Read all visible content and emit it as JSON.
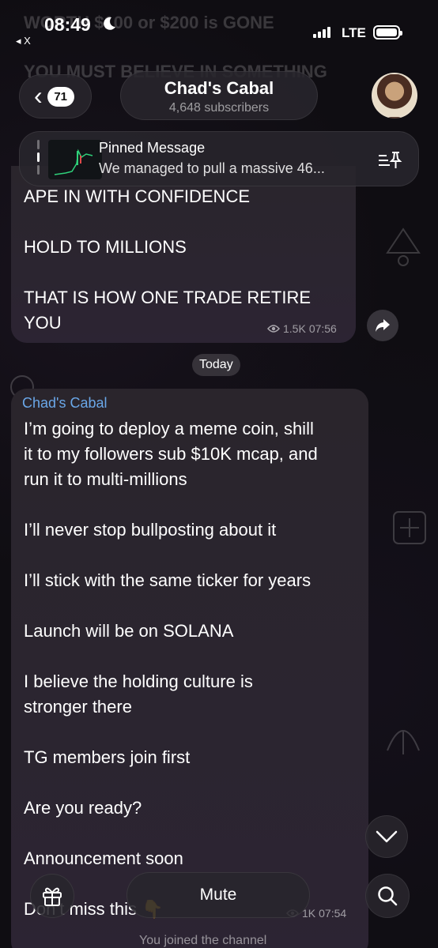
{
  "status_bar": {
    "time": "08:49",
    "back_app": "◂ X",
    "network": "LTE"
  },
  "ghost_text": {
    "line1": "WORTH $100 or $200 is GONE",
    "line2": "YOU MUST BELIEVE IN SOMETHING"
  },
  "header": {
    "back_badge": "71",
    "title": "Chad's Cabal",
    "subtitle": "4,648 subscribers"
  },
  "pinned": {
    "label": "Pinned Message",
    "text": "We managed to pull a massive 46..."
  },
  "message1": {
    "lines": [
      "APE IN WITH CONFIDENCE",
      "HOLD TO MILLIONS",
      "THAT IS HOW ONE TRADE RETIRE",
      "YOU"
    ],
    "views": "1.5K",
    "time": "07:56"
  },
  "date_separator": "Today",
  "message2": {
    "sender": "Chad's Cabal",
    "lines": [
      "I’m going to deploy a meme coin, shill",
      "it to my followers sub $10K mcap, and",
      "run it to multi-millions",
      "I’ll never stop bullposting about it",
      "I’ll stick with the same ticker for years",
      "Launch will be on SOLANA",
      "I believe the holding culture is",
      "stronger there",
      "TG members join first",
      "Are you ready?",
      "Announcement soon",
      "Don’t miss this 👇"
    ],
    "views": "1K",
    "time": "07:54"
  },
  "bottom_bar": {
    "mute_label": "Mute",
    "service_message": "You joined the channel"
  },
  "icons": {
    "back": "chevron-left-icon",
    "pin_list": "pin-list-icon",
    "forward": "forward-icon",
    "scroll_down": "chevron-down-icon",
    "gift": "gift-icon",
    "search": "search-icon",
    "views": "eye-icon"
  },
  "colors": {
    "sender_name": "#6aa7e8",
    "bubble": "#2a252c",
    "background": "#0f0d12"
  }
}
